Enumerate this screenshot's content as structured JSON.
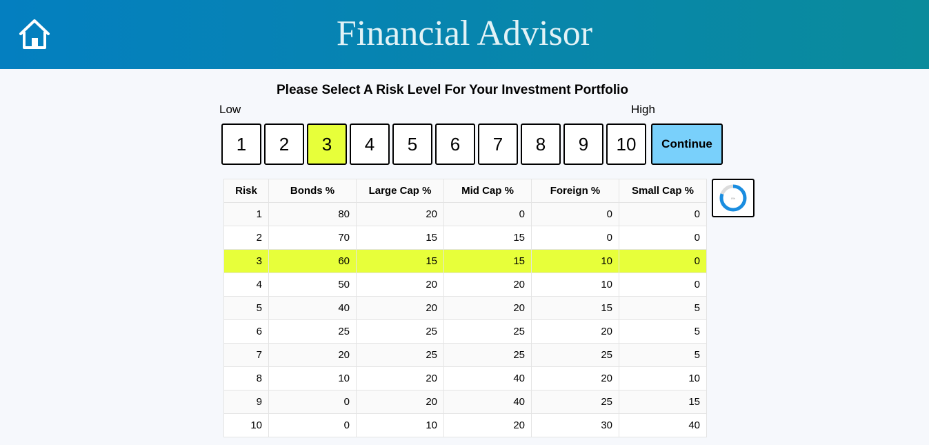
{
  "header": {
    "title": "Financial Advisor",
    "home_icon": "home-icon",
    "gradient_start": "#047fc0",
    "gradient_end": "#0a8b9c"
  },
  "selector": {
    "prompt": "Please Select A Risk Level For Your Investment Portfolio",
    "low_label": "Low",
    "high_label": "High",
    "levels": [
      "1",
      "2",
      "3",
      "4",
      "5",
      "6",
      "7",
      "8",
      "9",
      "10"
    ],
    "selected_level": 3,
    "selected_color": "#e7ff3a",
    "continue_label": "Continue",
    "continue_color": "#79d0fb"
  },
  "table": {
    "columns": [
      "Risk",
      "Bonds %",
      "Large Cap %",
      "Mid Cap %",
      "Foreign %",
      "Small Cap %"
    ],
    "rows": [
      [
        "1",
        "80",
        "20",
        "0",
        "0",
        "0"
      ],
      [
        "2",
        "70",
        "15",
        "15",
        "0",
        "0"
      ],
      [
        "3",
        "60",
        "15",
        "15",
        "10",
        "0"
      ],
      [
        "4",
        "50",
        "20",
        "20",
        "10",
        "0"
      ],
      [
        "5",
        "40",
        "20",
        "20",
        "15",
        "5"
      ],
      [
        "6",
        "25",
        "25",
        "25",
        "20",
        "5"
      ],
      [
        "7",
        "20",
        "25",
        "25",
        "25",
        "5"
      ],
      [
        "8",
        "10",
        "20",
        "40",
        "20",
        "10"
      ],
      [
        "9",
        "0",
        "20",
        "40",
        "25",
        "15"
      ],
      [
        "10",
        "0",
        "10",
        "20",
        "30",
        "40"
      ]
    ],
    "highlighted_row": 3
  },
  "chart_widget": {
    "icon": "donut-chart-icon",
    "label": "0%",
    "color": "#1a8de0"
  }
}
